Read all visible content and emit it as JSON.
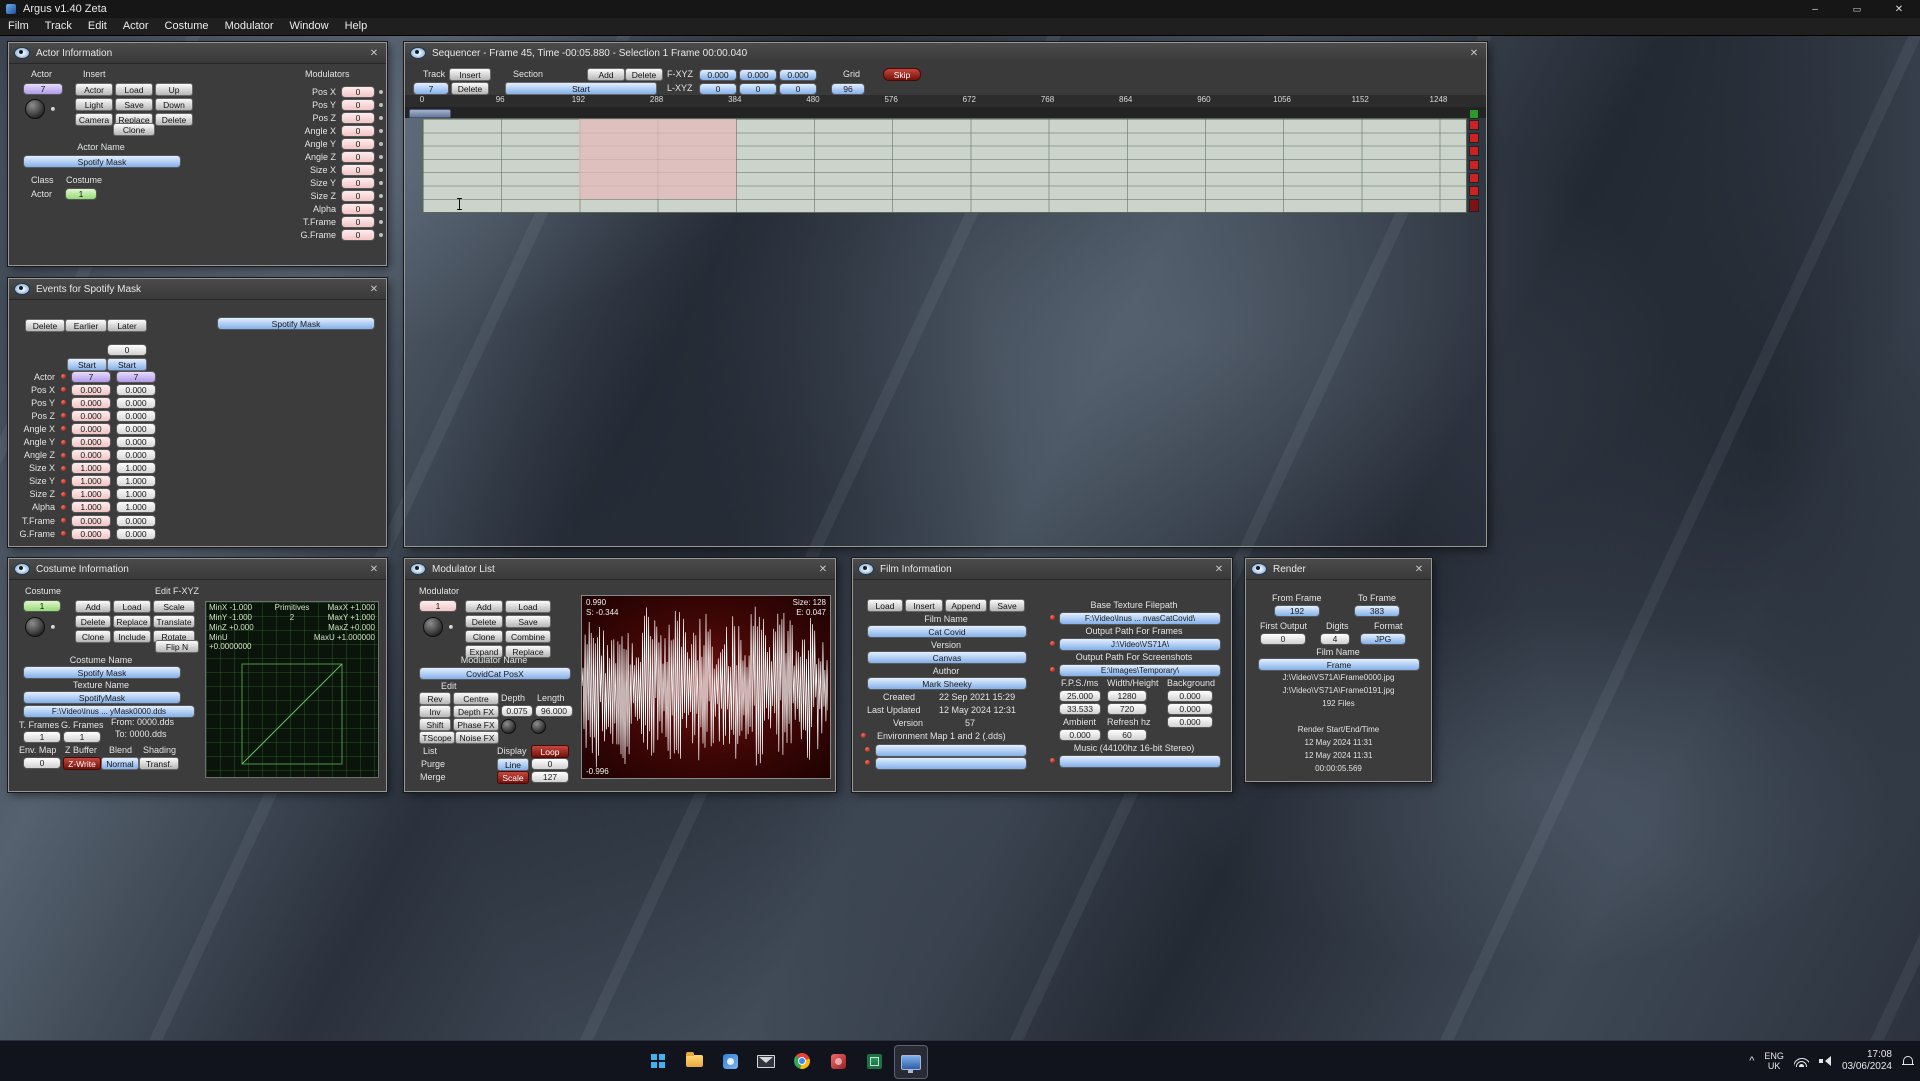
{
  "window": {
    "title": "Argus v1.40 Zeta",
    "menu": [
      "Film",
      "Track",
      "Edit",
      "Actor",
      "Costume",
      "Modulator",
      "Window",
      "Help"
    ]
  },
  "actor_info": {
    "title": "Actor Information",
    "actor_label": "Actor",
    "actor_value": "7",
    "insert_label": "Insert",
    "buttons": [
      "Actor",
      "Load",
      "Up",
      "Light",
      "Save",
      "Down",
      "Camera",
      "Replace",
      "Delete"
    ],
    "clone_button": "Clone",
    "actor_name_label": "Actor Name",
    "actor_name_value": "Spotify Mask",
    "class_label": "Class",
    "costume_label": "Costume",
    "class_value": "Actor",
    "costume_value": "1",
    "modulators_label": "Modulators",
    "modulator_rows": [
      {
        "label": "Pos X",
        "value": "0"
      },
      {
        "label": "Pos Y",
        "value": "0"
      },
      {
        "label": "Pos Z",
        "value": "0"
      },
      {
        "label": "Angle X",
        "value": "0"
      },
      {
        "label": "Angle Y",
        "value": "0"
      },
      {
        "label": "Angle Z",
        "value": "0"
      },
      {
        "label": "Size X",
        "value": "0"
      },
      {
        "label": "Size Y",
        "value": "0"
      },
      {
        "label": "Size Z",
        "value": "0"
      },
      {
        "label": "Alpha",
        "value": "0"
      },
      {
        "label": "T.Frame",
        "value": "0"
      },
      {
        "label": "G.Frame",
        "value": "0"
      }
    ]
  },
  "sequencer": {
    "title": "Sequencer - Frame 45, Time -00:05.880 - Selection 1 Frame 00:00.040",
    "track_label": "Track",
    "insert_button": "Insert",
    "section_label": "Section",
    "add_button": "Add",
    "delete_button": "Delete",
    "fxyz_label": "F-XYZ",
    "f_values": [
      "0.000",
      "0.000",
      "0.000"
    ],
    "grid_label": "Grid",
    "skip_button": "Skip",
    "track_value": "7",
    "delete2_button": "Delete",
    "start_button": "Start",
    "lxyz_label": "L-XYZ",
    "l_values": [
      "0",
      "0",
      "0"
    ],
    "grid_value": "96",
    "ruler": [
      "0",
      "96",
      "192",
      "288",
      "384",
      "480",
      "576",
      "672",
      "768",
      "864",
      "960",
      "1056",
      "1152",
      "1248"
    ]
  },
  "events": {
    "title": "Events for Spotify Mask",
    "delete_button": "Delete",
    "earlier_button": "Earlier",
    "later_button": "Later",
    "mask_name": "Spotify Mask",
    "top_value": "0",
    "start_button1": "Start",
    "start_button2": "Start",
    "rows": [
      {
        "label": "Actor",
        "v1": "7",
        "v2": "7"
      },
      {
        "label": "Pos X",
        "v1": "0.000",
        "v2": "0.000"
      },
      {
        "label": "Pos Y",
        "v1": "0.000",
        "v2": "0.000"
      },
      {
        "label": "Pos Z",
        "v1": "0.000",
        "v2": "0.000"
      },
      {
        "label": "Angle X",
        "v1": "0.000",
        "v2": "0.000"
      },
      {
        "label": "Angle Y",
        "v1": "0.000",
        "v2": "0.000"
      },
      {
        "label": "Angle Z",
        "v1": "0.000",
        "v2": "0.000"
      },
      {
        "label": "Size X",
        "v1": "1.000",
        "v2": "1.000"
      },
      {
        "label": "Size Y",
        "v1": "1.000",
        "v2": "1.000"
      },
      {
        "label": "Size Z",
        "v1": "1.000",
        "v2": "1.000"
      },
      {
        "label": "Alpha",
        "v1": "1.000",
        "v2": "1.000"
      },
      {
        "label": "T.Frame",
        "v1": "0.000",
        "v2": "0.000"
      },
      {
        "label": "G.Frame",
        "v1": "0.000",
        "v2": "0.000"
      }
    ]
  },
  "costume": {
    "title": "Costume Information",
    "costume_label": "Costume",
    "costume_value": "1",
    "edit_fxyz_label": "Edit F-XYZ",
    "buttons": [
      "Add",
      "Load",
      "Scale",
      "Delete",
      "Replace",
      "Translate",
      "Clone",
      "Include",
      "Rotate"
    ],
    "flipn_button": "Flip N",
    "costume_name_label": "Costume Name",
    "costume_name_value": "Spotify Mask",
    "texture_name_label": "Texture Name",
    "texture_name_value": "SpotifyMask",
    "texture_path": "F:\\Video\\Inus ... yMask0000.dds",
    "tframes_label": "T. Frames",
    "gframes_label": "G. Frames",
    "from_label": "From: 0000.dds",
    "to_label": "To: 0000.dds",
    "tframes_value": "1",
    "gframes_value": "1",
    "env_map_label": "Env. Map",
    "zbuffer_label": "Z Buffer",
    "blend_label": "Blend",
    "shading_label": "Shading",
    "env_value": "0",
    "zwrite_button": "Z-Write",
    "normal_button": "Normal",
    "transf_button": "Transf.",
    "viewport": {
      "minx": "MinX -1.000",
      "miny": "MinY -1.000",
      "minz": "MinZ +0.000",
      "minu": "MinU +0.0000000",
      "primitives_label": "Primitives",
      "primitives_value": "2",
      "maxx": "MaxX +1.000",
      "maxy": "MaxY +1.000",
      "maxz": "MaxZ +0.000",
      "maxu": "MaxU +1.000000"
    }
  },
  "modulator": {
    "title": "Modulator List",
    "modulator_label": "Modulator",
    "modulator_value": "1",
    "buttons": [
      "Add",
      "Load",
      "Delete",
      "Save",
      "Clone",
      "Combine",
      "Expand",
      "Replace"
    ],
    "name_label": "Modulator Name",
    "name_value": "CovidCat PosX",
    "edit_label": "Edit",
    "rev_button": "Rev",
    "centre_button": "Centre",
    "depth_label": "Depth",
    "length_label": "Length",
    "inv_button": "Inv",
    "depthfx_button": "Depth FX",
    "depth_value": "0.075",
    "length_value": "96.000",
    "shift_button": "Shift",
    "phasefx_button": "Phase FX",
    "tscope_button": "TScope",
    "noisefx_button": "Noise FX",
    "list_label": "List",
    "display_label": "Display",
    "loop_button": "Loop",
    "purge_label": "Purge",
    "line_button": "Line",
    "line_value": "0",
    "merge_label": "Merge",
    "scale_button": "Scale",
    "scale_value": "127",
    "wave": {
      "top_left": "0.990",
      "s_value": "S: -0.344",
      "size_value": "Size: 128",
      "e_value": "E: 0.047",
      "bottom_left": "-0.996"
    }
  },
  "film": {
    "title": "Film Information",
    "buttons": [
      "Load",
      "Insert",
      "Append",
      "Save"
    ],
    "film_name_label": "Film Name",
    "film_name_value": "Cat Covid",
    "version_label": "Version",
    "version_value": "Canvas",
    "author_label": "Author",
    "author_value": "Mark Sheeky",
    "created_label": "Created",
    "created_value": "22 Sep 2021 15:29",
    "updated_label": "Last Updated",
    "updated_value": "12 May 2024 12:31",
    "version2_label": "Version",
    "version2_value": "57",
    "env_label": "Environment Map 1 and 2 (.dds)",
    "base_texture_label": "Base Texture Filepath",
    "base_texture_value": "F:\\Video\\Inus ... nvasCatCovid\\",
    "frames_path_label": "Output Path For Frames",
    "frames_path_value": "J:\\Video\\VS71A\\",
    "screens_path_label": "Output Path For Screenshots",
    "screens_path_value": "E:\\Images\\Temporary\\",
    "fps_label": "F.P.S./ms",
    "wh_label": "Width/Height",
    "bg_label": "Background",
    "fps_values": [
      "25.000",
      "33.533"
    ],
    "wh_values": [
      "1280",
      "720"
    ],
    "bg_values": [
      "0.000",
      "0.000",
      "0.000"
    ],
    "ambient_label": "Ambient",
    "refresh_label": "Refresh hz",
    "ambient_value": "0.000",
    "refresh_value": "60",
    "music_label": "Music (44100hz 16-bit Stereo)"
  },
  "render": {
    "title": "Render",
    "from_label": "From Frame",
    "to_label": "To Frame",
    "from_value": "192",
    "to_value": "383",
    "first_output_label": "First Output",
    "digits_label": "Digits",
    "format_label": "Format",
    "first_output_value": "0",
    "digits_value": "4",
    "format_value": "JPG",
    "film_name_label": "Film Name",
    "film_name_value": "Frame",
    "path1": "J:\\Video\\VS71A\\Frame0000.jpg",
    "path2": "J:\\Video\\VS71A\\Frame0191.jpg",
    "files_count": "192 Files",
    "render_label": "Render Start/End/Time",
    "start_time": "12 May 2024 11:31",
    "end_time": "12 May 2024 11:31",
    "elapsed": "00:00:05.569"
  },
  "taskbar": {
    "tray_caret": "^",
    "lang": "ENG",
    "region": "UK",
    "time": "17:08",
    "date": "03/06/2024"
  }
}
